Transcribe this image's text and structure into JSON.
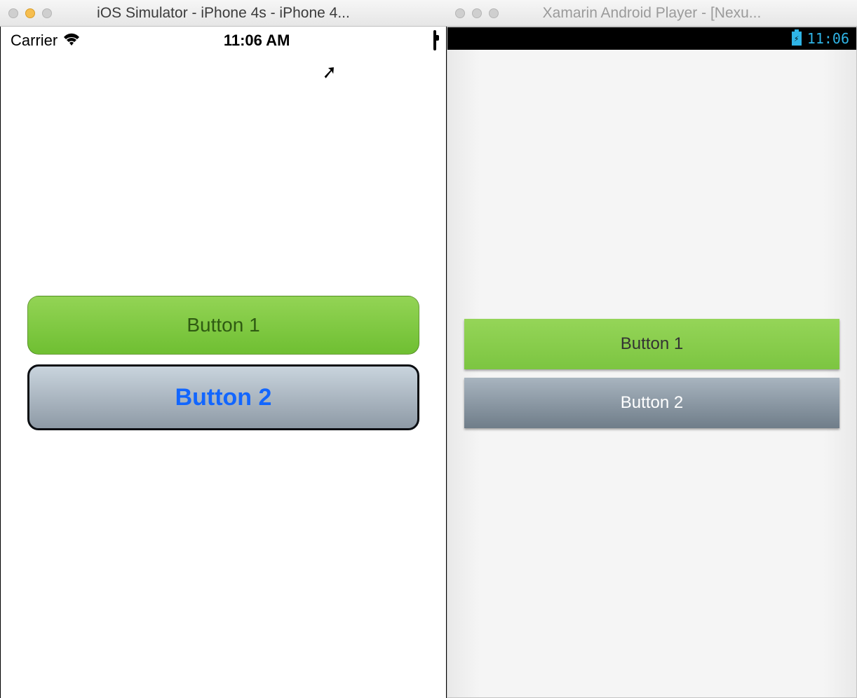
{
  "ios": {
    "window_title": "iOS Simulator - iPhone 4s - iPhone 4...",
    "status": {
      "carrier": "Carrier",
      "time": "11:06 AM"
    },
    "buttons": {
      "one": "Button 1",
      "two": "Button 2"
    }
  },
  "android": {
    "window_title": "Xamarin Android Player - [Nexu...",
    "status": {
      "time": "11:06"
    },
    "buttons": {
      "one": "Button 1",
      "two": "Button 2"
    }
  }
}
